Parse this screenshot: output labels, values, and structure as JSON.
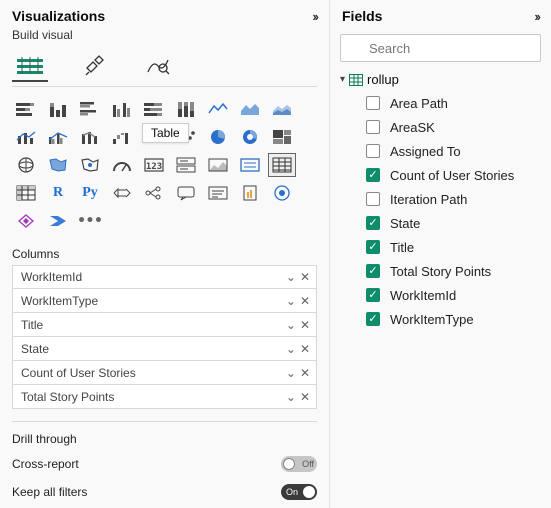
{
  "visualizations": {
    "title": "Visualizations",
    "build_label": "Build visual",
    "tooltip": "Table",
    "columns_label": "Columns",
    "columns": [
      {
        "label": "WorkItemId"
      },
      {
        "label": "WorkItemType"
      },
      {
        "label": "Title"
      },
      {
        "label": "State"
      },
      {
        "label": "Count of User Stories"
      },
      {
        "label": "Total Story Points"
      }
    ],
    "drill_label": "Drill through",
    "cross_report_label": "Cross-report",
    "cross_report_value": "Off",
    "keep_filters_label": "Keep all filters",
    "keep_filters_value": "On"
  },
  "fields": {
    "title": "Fields",
    "search_placeholder": "Search",
    "table_name": "rollup",
    "items": [
      {
        "label": "Area Path",
        "checked": false
      },
      {
        "label": "AreaSK",
        "checked": false
      },
      {
        "label": "Assigned To",
        "checked": false
      },
      {
        "label": "Count of User Stories",
        "checked": true
      },
      {
        "label": "Iteration Path",
        "checked": false
      },
      {
        "label": "State",
        "checked": true
      },
      {
        "label": "Title",
        "checked": true
      },
      {
        "label": "Total Story Points",
        "checked": true
      },
      {
        "label": "WorkItemId",
        "checked": true
      },
      {
        "label": "WorkItemType",
        "checked": true
      }
    ]
  }
}
